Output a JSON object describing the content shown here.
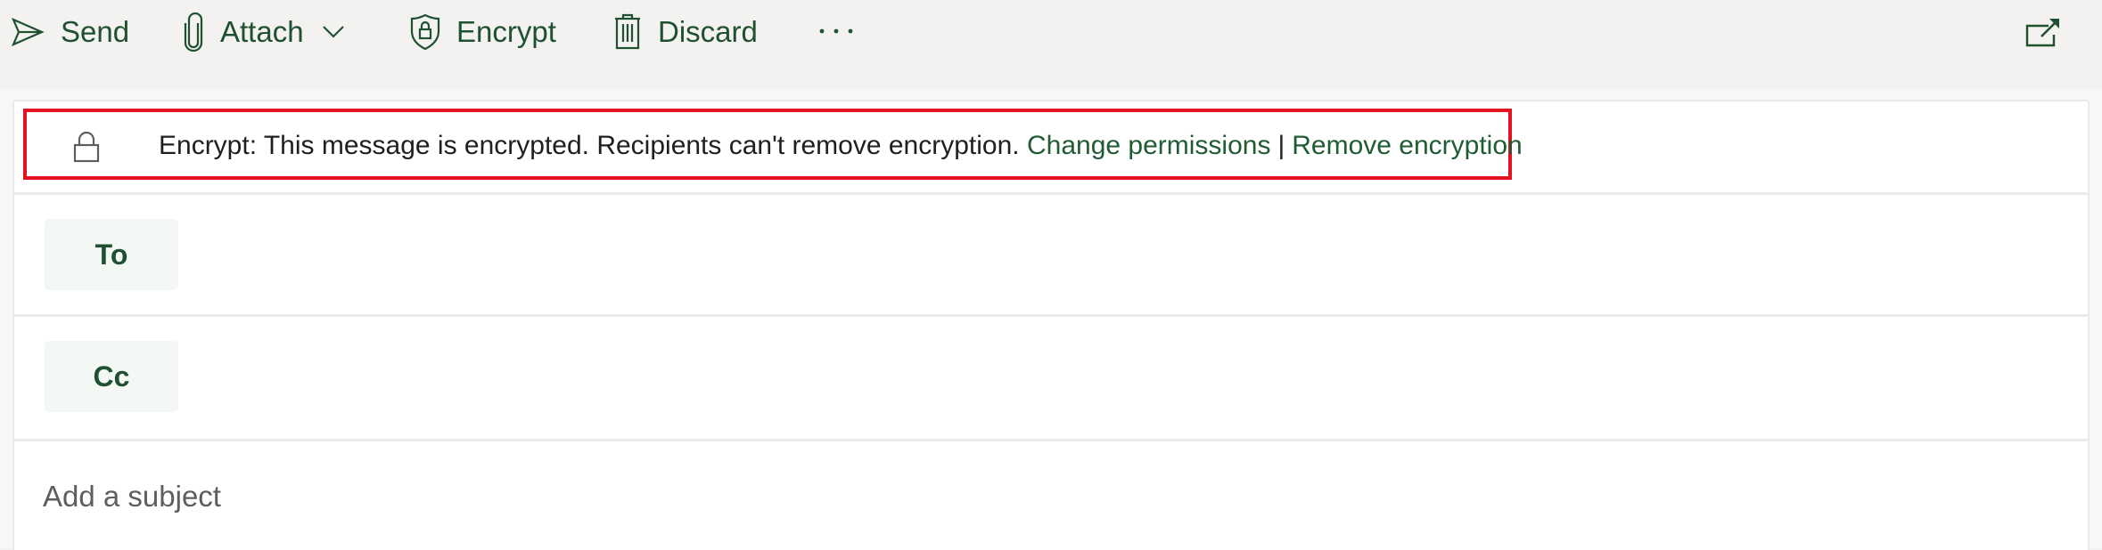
{
  "toolbar": {
    "send_label": "Send",
    "attach_label": "Attach",
    "encrypt_label": "Encrypt",
    "discard_label": "Discard",
    "more_label": "···",
    "icons": {
      "send": "send-icon",
      "attach": "paperclip-icon",
      "attach_dropdown": "chevron-down-icon",
      "encrypt": "shield-lock-icon",
      "discard": "trash-icon",
      "more": "more-icon",
      "popout": "popout-icon"
    }
  },
  "encryption_banner": {
    "icon": "lock-icon",
    "message": "Encrypt: This message is encrypted. Recipients can't remove encryption.",
    "change_permissions_label": "Change permissions",
    "separator": "|",
    "remove_encryption_label": "Remove encryption",
    "highlight_color": "#e3141f"
  },
  "recipients": {
    "to_label": "To",
    "to_value": "",
    "cc_label": "Cc",
    "cc_value": ""
  },
  "subject": {
    "placeholder": "Add a subject",
    "value": ""
  },
  "colors": {
    "accent": "#1f5130",
    "link": "#1f5c34",
    "toolbar_bg": "#f3f2f1"
  }
}
